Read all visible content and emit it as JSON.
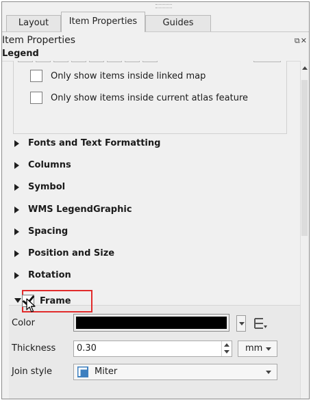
{
  "tabs": [
    {
      "label": "Layout",
      "active": false
    },
    {
      "label": "Item Properties",
      "active": true
    },
    {
      "label": "Guides",
      "active": false
    }
  ],
  "dock_title": "Item Properties",
  "item_title": "Legend",
  "checkboxes": [
    {
      "label": "Only show items inside linked map",
      "checked": false
    },
    {
      "label": "Only show items inside current atlas feature",
      "checked": false
    }
  ],
  "sections": [
    "Fonts and Text Formatting",
    "Columns",
    "Symbol",
    "WMS LegendGraphic",
    "Spacing",
    "Position and Size",
    "Rotation"
  ],
  "frame": {
    "label": "Frame",
    "checked": true,
    "color_label": "Color",
    "color_value": "#000000",
    "thickness_label": "Thickness",
    "thickness_value": "0.30",
    "unit": "mm",
    "join_label": "Join style",
    "join_value": "Miter"
  },
  "colors": {
    "highlight": "#e12a2a"
  }
}
